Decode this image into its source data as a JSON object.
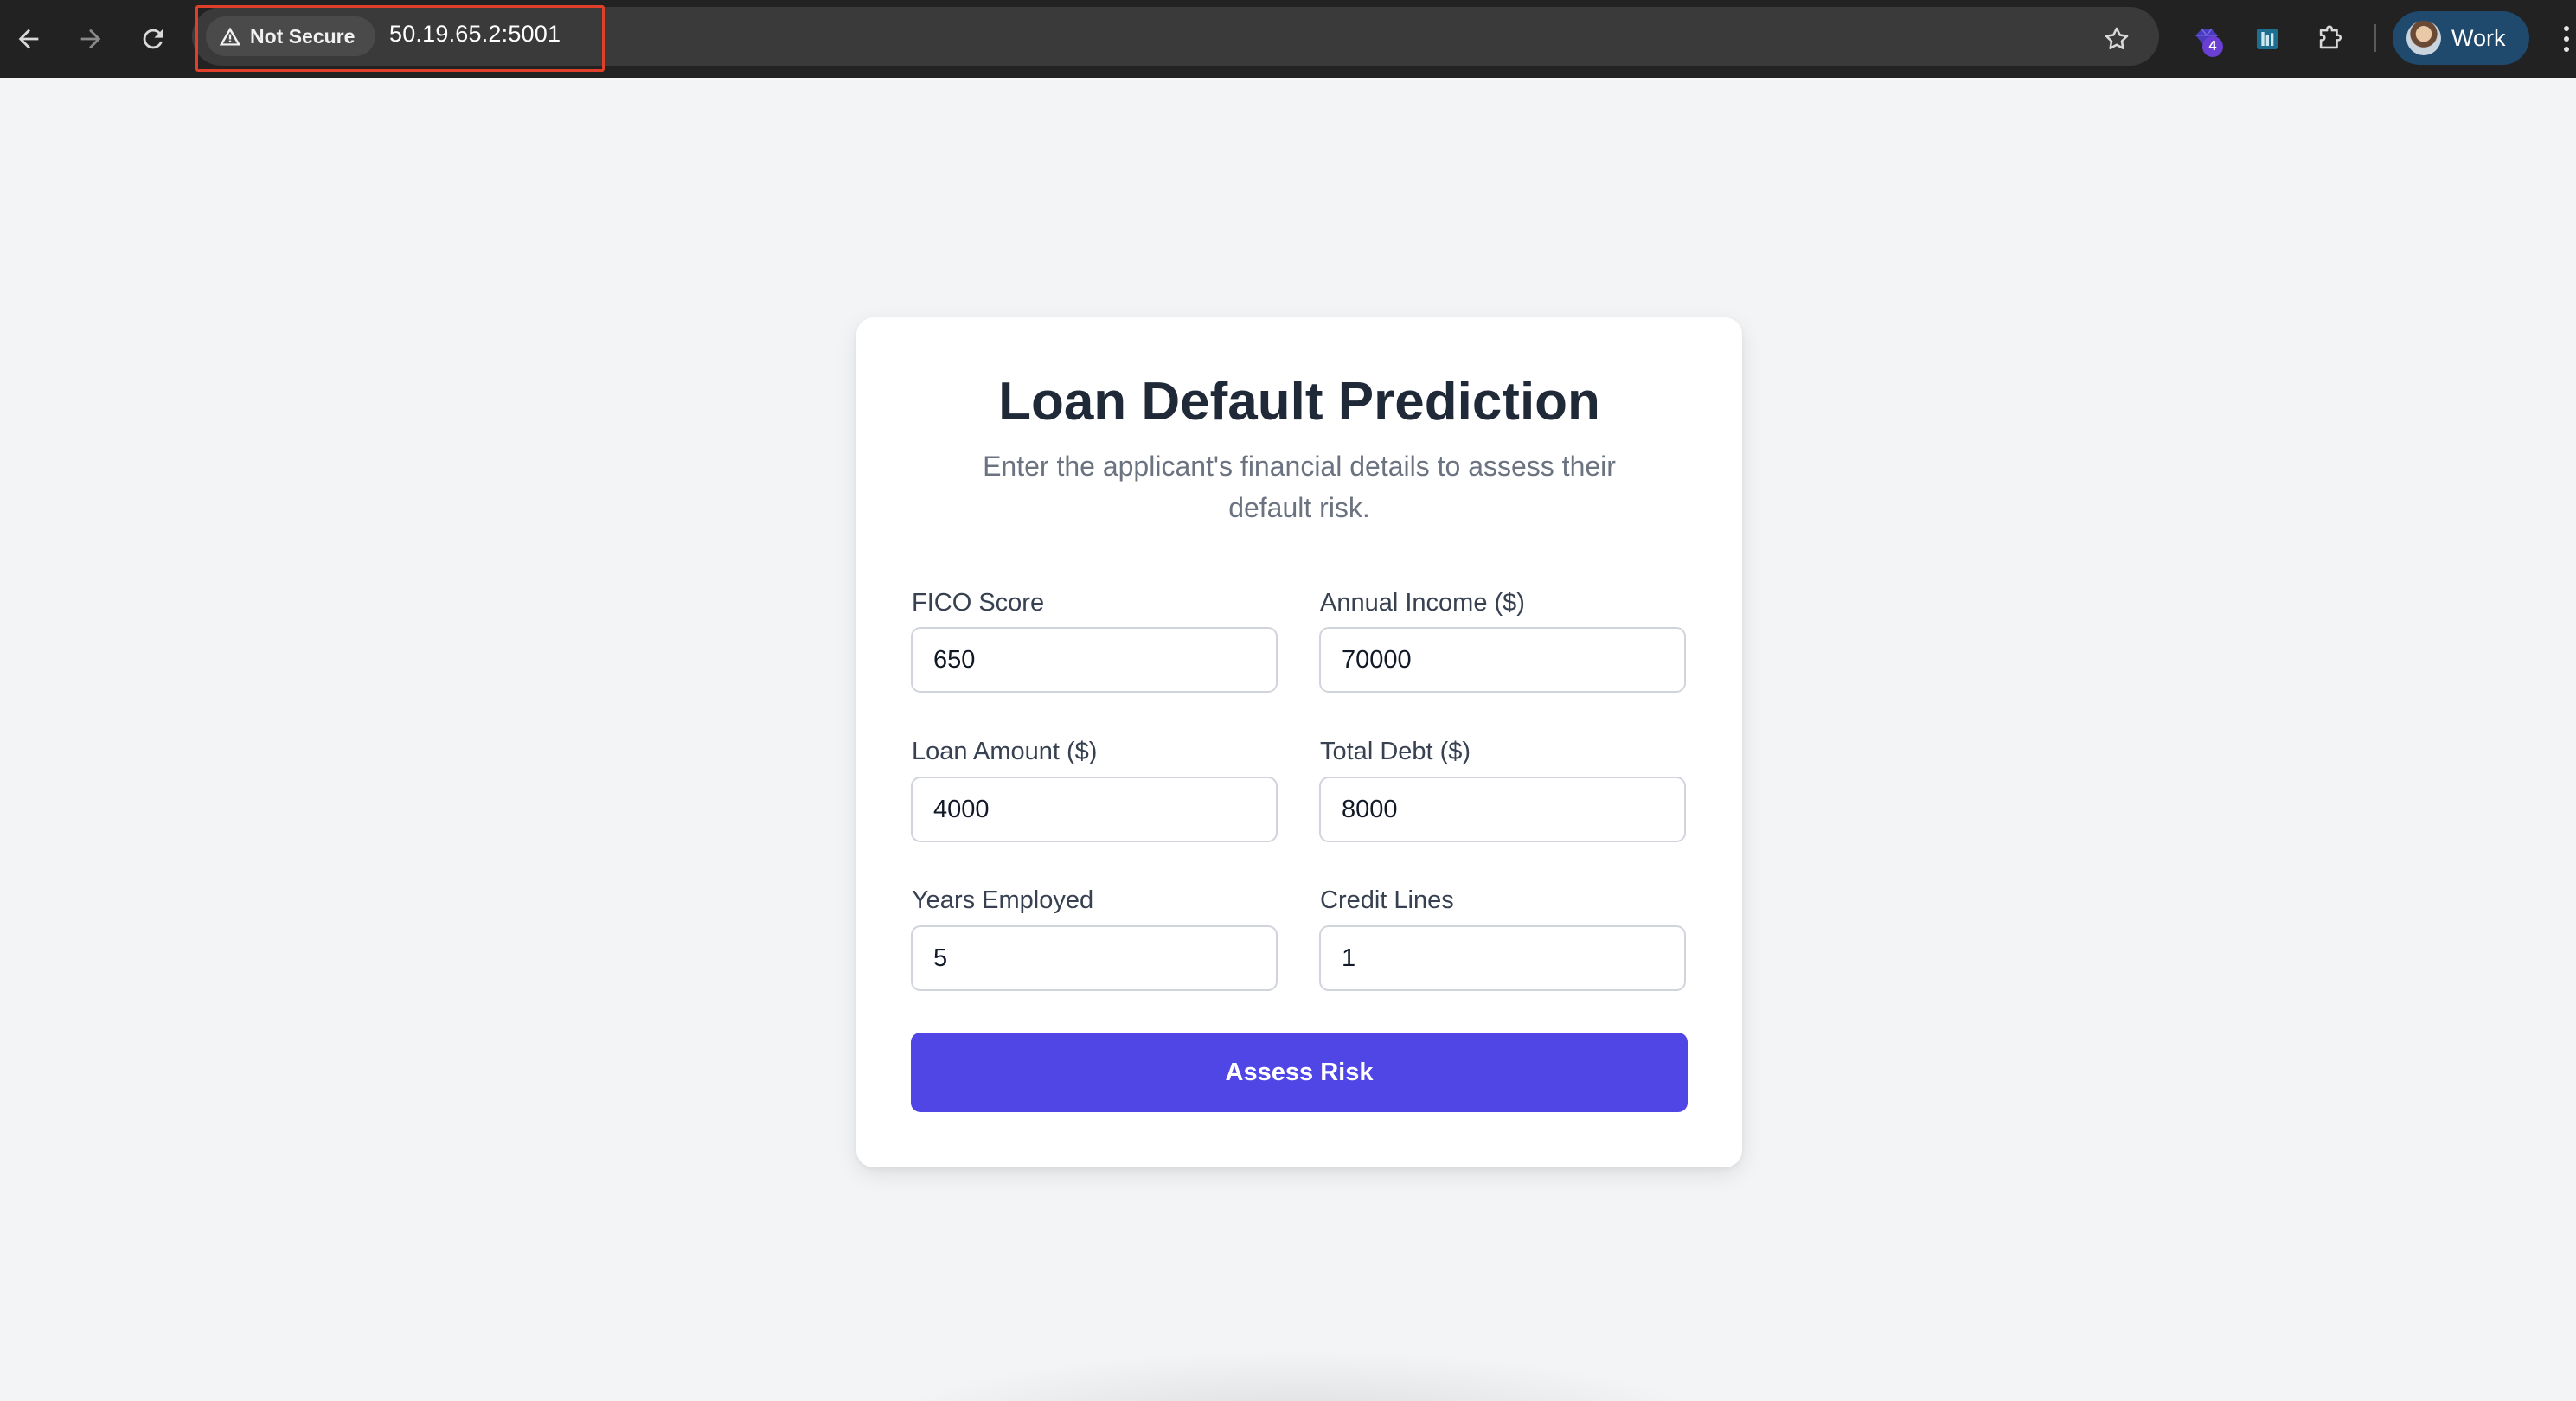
{
  "browser": {
    "security_label": "Not Secure",
    "url": "50.19.65.2:5001",
    "extension_badge": "4",
    "profile_label": "Work"
  },
  "form": {
    "title": "Loan Default Prediction",
    "subtitle": "Enter the applicant's financial details to assess their default risk.",
    "fields": [
      {
        "label": "FICO Score",
        "value": "650"
      },
      {
        "label": "Annual Income ($)",
        "value": "70000"
      },
      {
        "label": "Loan Amount ($)",
        "value": "4000"
      },
      {
        "label": "Total Debt ($)",
        "value": "8000"
      },
      {
        "label": "Years Employed",
        "value": "5"
      },
      {
        "label": "Credit Lines",
        "value": "1"
      }
    ],
    "submit_label": "Assess Risk"
  },
  "colors": {
    "accent": "#4f46e5",
    "chrome": "#222222",
    "page_background": "#f3f4f6",
    "highlight": "#e0402a"
  }
}
